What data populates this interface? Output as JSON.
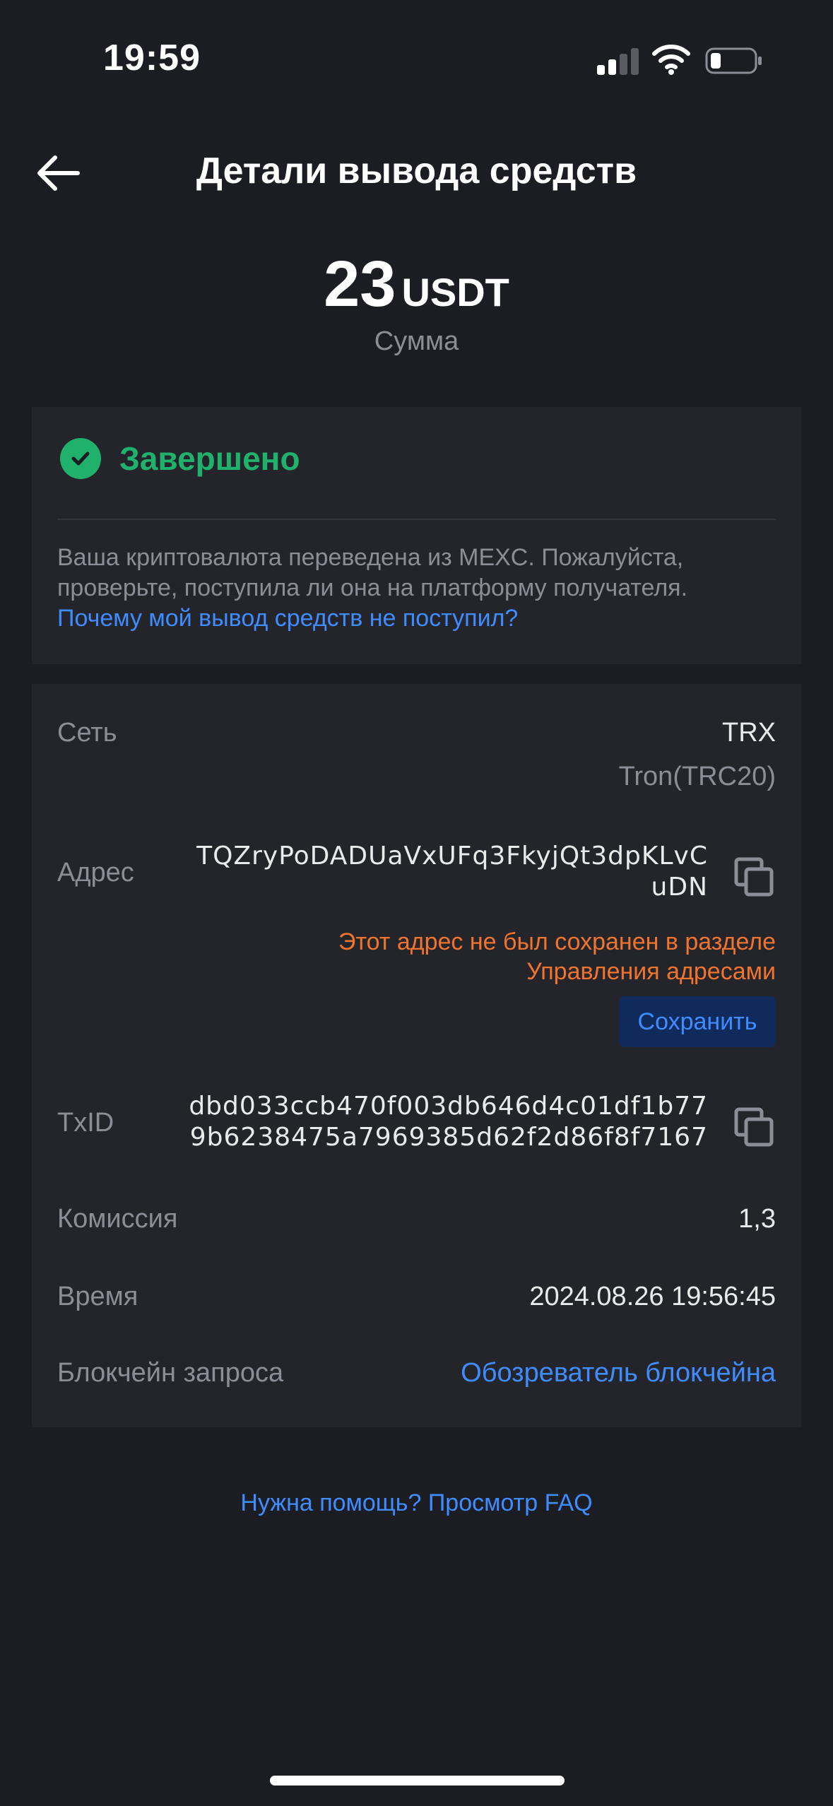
{
  "status_bar": {
    "time": "19:59",
    "signal_icon": "cellular-signal-icon",
    "wifi_icon": "wifi-icon",
    "battery_icon": "battery-low-icon"
  },
  "header": {
    "back_icon": "arrow-left-icon",
    "title": "Детали вывода средств"
  },
  "amount": {
    "value": "23",
    "unit": "USDT",
    "label": "Сумма"
  },
  "status_card": {
    "status_icon": "check-circle-icon",
    "status": "Завершено",
    "description": "Ваша криптовалюта переведена из MEXC. Пожалуйста, проверьте, поступила ли она на платформу получателя.",
    "help_link": "Почему мой вывод средств не поступил?"
  },
  "details": {
    "network": {
      "label": "Сеть",
      "value": "TRX",
      "sub": "Tron(TRC20)"
    },
    "address": {
      "label": "Адрес",
      "value_line1": "TQZryPoDADUaVxUFq3FkyjQt3dpKLvC",
      "value_line2": "uDN",
      "warning_line1": "Этот адрес не был сохранен в разделе",
      "warning_line2": "Управления адресами",
      "save_button": "Сохранить",
      "copy_icon": "copy-icon"
    },
    "txid": {
      "label": "TxID",
      "value_line1": "dbd033ccb470f003db646d4c01df1b77",
      "value_line2": "9b6238475a7969385d62f2d86f8f7167",
      "copy_icon": "copy-icon"
    },
    "fee": {
      "label": "Комиссия",
      "value": "1,3"
    },
    "time": {
      "label": "Время",
      "value": "2024.08.26 19:56:45"
    },
    "blockchain": {
      "label": "Блокчейн запроса",
      "link": "Обозреватель блокчейна"
    }
  },
  "footer": {
    "faq_link": "Нужна помощь? Просмотр FAQ"
  },
  "colors": {
    "background": "#1c1d22",
    "card": "#24252b",
    "success": "#20b26c",
    "link": "#3f8cff",
    "warning": "#f0742e",
    "muted": "#8b8e96"
  }
}
